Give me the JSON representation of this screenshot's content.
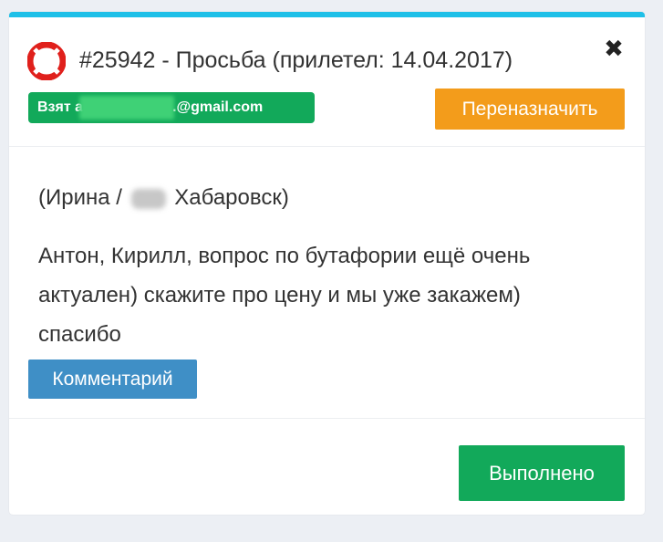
{
  "ticket": {
    "id_title": "#25942 - Просьба (прилетел: 14.04.2017)",
    "icon": "lifebuoy-icon",
    "close_icon": "✖",
    "taken_prefix": "Взят",
    "taken_suffix": ".@gmail.com",
    "reassign_label": "Переназначить"
  },
  "body": {
    "author_prefix": "(Ирина /",
    "author_city": "Хабаровск)",
    "message": "Антон, Кирилл, вопрос по бутафории ещё очень актуален) скажите про цену и мы уже закажем) спасибо",
    "comment_label": "Комментарий"
  },
  "footer": {
    "done_label": "Выполнено"
  },
  "colors": {
    "accent_top": "#1ec0e8",
    "green": "#12a95a",
    "orange": "#f39c1b",
    "blue": "#3f8fc6",
    "lifebuoy_red": "#e0201c"
  }
}
